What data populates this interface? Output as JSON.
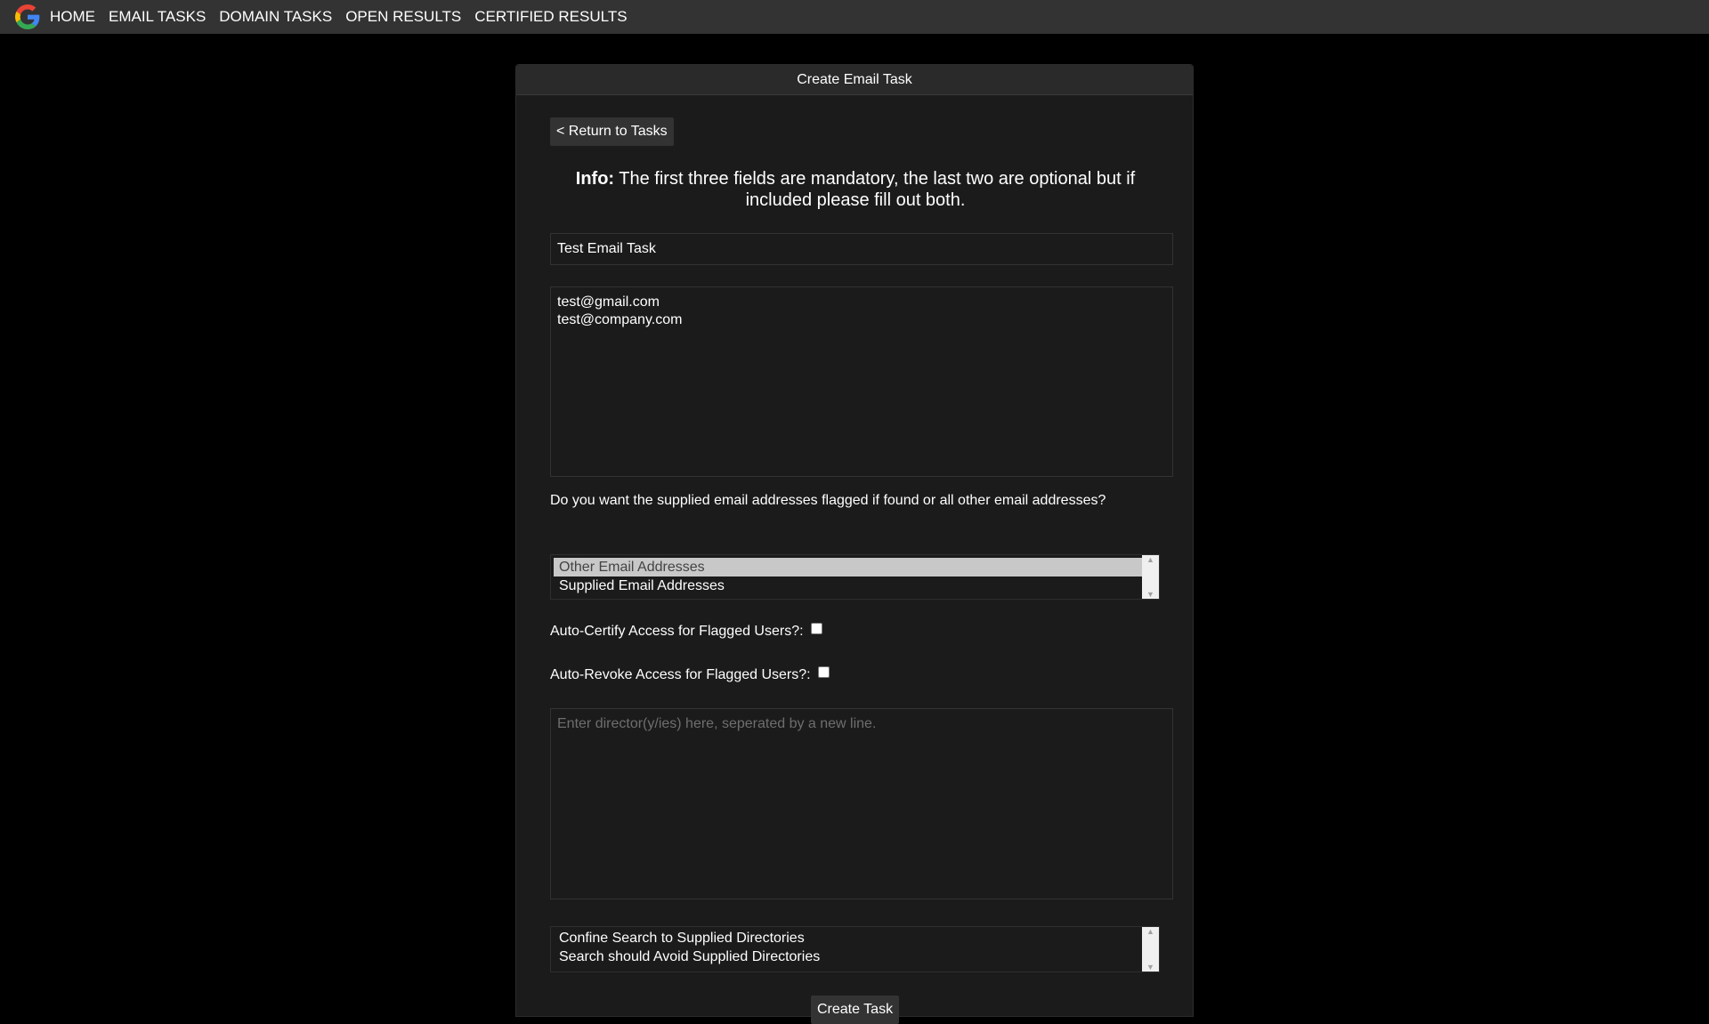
{
  "nav": {
    "items": [
      "HOME",
      "EMAIL TASKS",
      "DOMAIN TASKS",
      "OPEN RESULTS",
      "CERTIFIED RESULTS"
    ]
  },
  "panel": {
    "title": "Create Email Task",
    "return_label": "< Return to Tasks",
    "info_label": "Info:",
    "info_text": " The first three fields are mandatory, the last two are optional but if included please fill out both."
  },
  "form": {
    "task_name": "Test Email Task",
    "emails": "test@gmail.com\ntest@company.com",
    "flag_question": "Do you want the supplied email addresses flagged if found or all other email addresses?",
    "flag_options": [
      "Other Email Addresses",
      "Supplied Email Addresses"
    ],
    "flag_selected": "Other Email Addresses",
    "auto_certify_label": "Auto-Certify Access for Flagged Users?:",
    "auto_certify_checked": false,
    "auto_revoke_label": "Auto-Revoke Access for Flagged Users?:",
    "auto_revoke_checked": false,
    "directories_placeholder": "Enter director(y/ies) here, seperated by a new line.",
    "directory_options": [
      "Confine Search to Supplied Directories",
      "Search should Avoid Supplied Directories"
    ],
    "create_label": "Create Task"
  },
  "colors": {
    "navbar": "#333333",
    "background": "#000000",
    "panel": "#1b1b1b",
    "text": "#ffffff"
  },
  "icons": {
    "logo": "google-g-logo",
    "scroll_up": "triangle-up",
    "scroll_down": "triangle-down"
  }
}
